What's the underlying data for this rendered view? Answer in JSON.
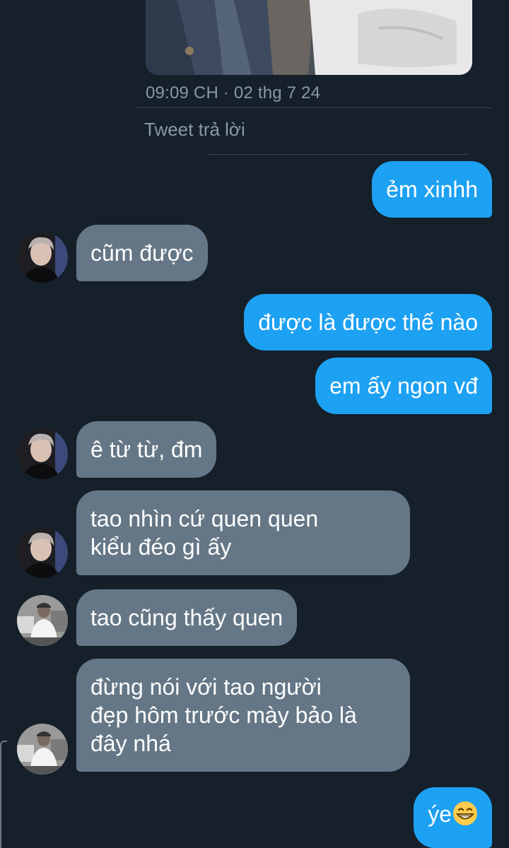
{
  "tweet": {
    "timestamp": "09:09 CH · 02 thg 7 24",
    "reply_label": "Tweet trả lời"
  },
  "messages": [
    {
      "direction": "outgoing",
      "text": "ẻm xinhh"
    },
    {
      "direction": "incoming",
      "sender_avatar": "avatar-a",
      "text": "cũm được"
    },
    {
      "direction": "outgoing",
      "text": "được là được thế nào"
    },
    {
      "direction": "outgoing",
      "text": "em ấy ngon vđ"
    },
    {
      "direction": "incoming",
      "sender_avatar": "avatar-a",
      "text": "ê từ từ, đm"
    },
    {
      "direction": "incoming",
      "sender_avatar": "avatar-a",
      "lines": [
        "tao nhìn cứ quen quen",
        "kiểu đéo gì ấy"
      ]
    },
    {
      "direction": "incoming",
      "sender_avatar": "avatar-b",
      "text": "tao cũng thấy quen"
    },
    {
      "direction": "incoming",
      "sender_avatar": "avatar-b",
      "lines": [
        "đừng nói với tao người",
        "đẹp hôm trước mày bảo là",
        "đây nhá"
      ]
    },
    {
      "direction": "outgoing",
      "text": "ýe",
      "emoji": "grinning-face-icon"
    }
  ],
  "colors": {
    "background": "#15202b",
    "outgoing_bubble": "#1da1f2",
    "incoming_bubble": "#657786",
    "meta_text": "#8899a6"
  }
}
